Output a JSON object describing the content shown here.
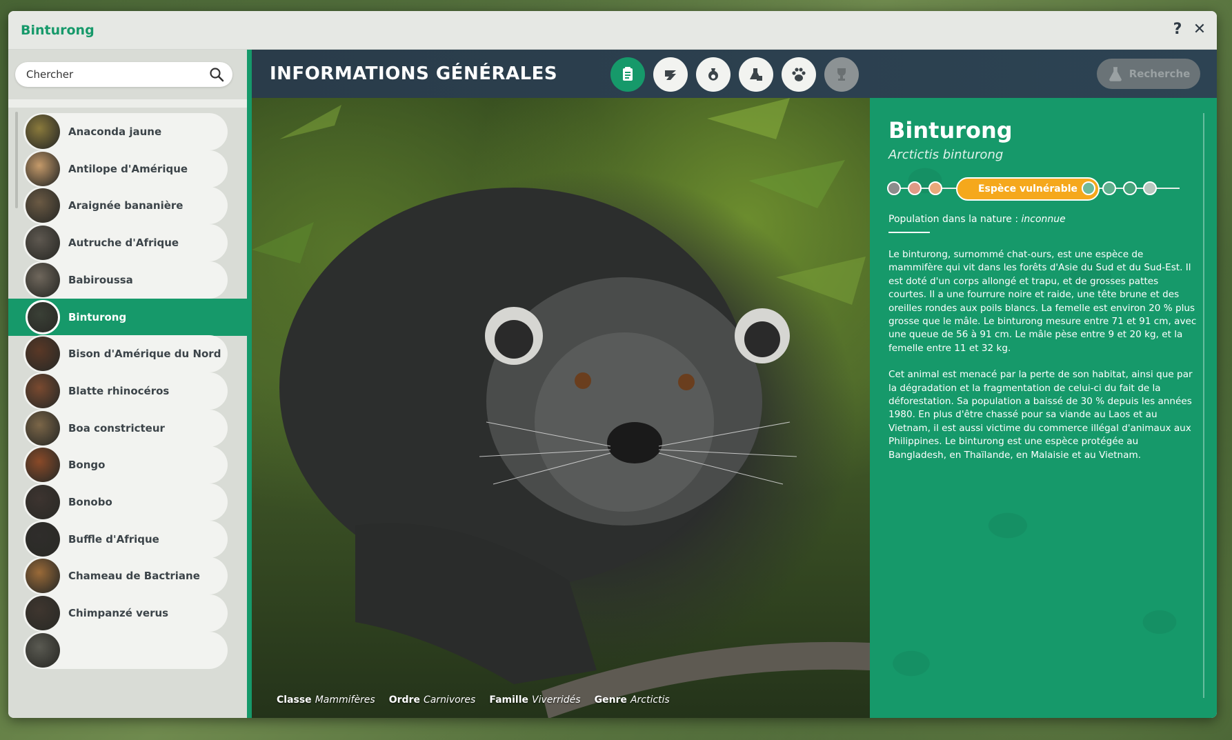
{
  "window": {
    "title": "Binturong"
  },
  "search": {
    "placeholder": "Chercher"
  },
  "sidebar": {
    "items": [
      {
        "label": "Anaconda jaune",
        "thumb_color": "#8a7a3c"
      },
      {
        "label": "Antilope d'Amérique",
        "thumb_color": "#c59a6a"
      },
      {
        "label": "Araignée bananière",
        "thumb_color": "#6b5a44"
      },
      {
        "label": "Autruche d'Afrique",
        "thumb_color": "#5e5850"
      },
      {
        "label": "Babiroussa",
        "thumb_color": "#6f675c"
      },
      {
        "label": "Binturong",
        "thumb_color": "#3a4036",
        "selected": true
      },
      {
        "label": "Bison d'Amérique du Nord",
        "thumb_color": "#5a3826"
      },
      {
        "label": "Blatte rhinocéros",
        "thumb_color": "#7a4a30"
      },
      {
        "label": "Boa constricteur",
        "thumb_color": "#7b6648"
      },
      {
        "label": "Bongo",
        "thumb_color": "#8a4a28"
      },
      {
        "label": "Bonobo",
        "thumb_color": "#3d3430"
      },
      {
        "label": "Buffle d'Afrique",
        "thumb_color": "#2f2d2b"
      },
      {
        "label": "Chameau de Bactriane",
        "thumb_color": "#9a6a38"
      },
      {
        "label": "Chimpanzé verus",
        "thumb_color": "#3f362f"
      },
      {
        "label": "",
        "thumb_color": "#5a5a52"
      }
    ]
  },
  "header": {
    "heading": "INFORMATIONS GÉNÉRALES",
    "tabs": [
      {
        "icon": "clipboard-icon",
        "active": true
      },
      {
        "icon": "habitat-icon"
      },
      {
        "icon": "food-icon"
      },
      {
        "icon": "enrichment-icon"
      },
      {
        "icon": "paw-icon"
      },
      {
        "icon": "trophy-icon",
        "disabled": true
      }
    ],
    "research_label": "Recherche"
  },
  "taxonomy": {
    "classe_label": "Classe",
    "classe": "Mammifères",
    "ordre_label": "Ordre",
    "ordre": "Carnivores",
    "famille_label": "Famille",
    "famille": "Viverridés",
    "genre_label": "Genre",
    "genre": "Arctictis"
  },
  "info": {
    "name": "Binturong",
    "latin": "Arctictis binturong",
    "status": "Espèce vulnérable",
    "status_colors": {
      "left": [
        "#8c8c8c",
        "#e09a86",
        "#e8a87a"
      ],
      "active": "#f5a81c",
      "right": [
        "#6fb99a",
        "#5fb08e",
        "#47a47c",
        "#b9c8c0"
      ]
    },
    "population_label": "Population dans la nature :",
    "population_value": "inconnue",
    "paragraph1": "Le binturong, surnommé chat-ours, est une espèce de mammifère qui vit dans les forêts d'Asie du Sud et du Sud-Est. Il est doté d'un corps allongé et trapu, et de grosses pattes courtes. Il a une fourrure noire et raide, une tête brune et des oreilles rondes aux poils blancs. La femelle est environ 20 % plus grosse que le mâle. Le binturong mesure entre 71 et 91 cm, avec une queue de 56 à 91 cm. Le mâle pèse entre 9 et 20 kg, et la femelle entre 11 et 32 kg.",
    "paragraph2": "Cet animal est menacé par la perte de son habitat, ainsi que par la dégradation et la fragmentation de celui-ci du fait de la déforestation. Sa population a baissé de 30 % depuis les années 1980. En plus d'être chassé pour sa viande au Laos et au Vietnam, il est aussi victime du commerce illégal d'animaux aux Philippines. Le binturong est une espèce protégée au Bangladesh, en Thaïlande, en Malaisie et au Vietnam."
  },
  "colors": {
    "accent": "#16996a",
    "header": "#2a3c4a",
    "status": "#f5a81c"
  }
}
